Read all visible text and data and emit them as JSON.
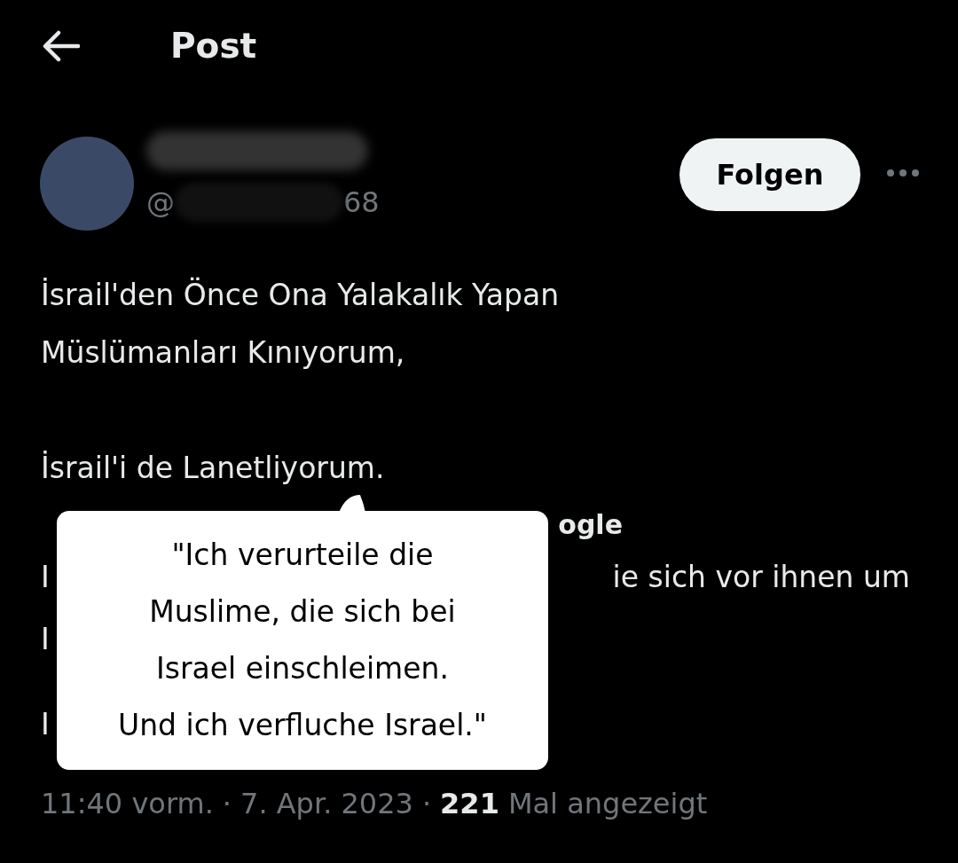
{
  "header": {
    "title": "Post"
  },
  "author": {
    "handle_start": "@",
    "handle_end": "68"
  },
  "follow_button": {
    "label": "Folgen"
  },
  "post": {
    "lines": [
      "İsrail'den Önce Ona Yalakalık Yapan",
      "Müslümanları Kınıyorum,",
      "İsrail'i de Lanetliyorum."
    ]
  },
  "translation": {
    "link_fragment": "ogle",
    "rows": [
      {
        "left": "I",
        "right": "ie sich vor ihnen um"
      },
      {
        "left": "I",
        "right": ""
      },
      {
        "left": "I",
        "right": ""
      }
    ]
  },
  "meta": {
    "separator": "·",
    "time": "11:40 vorm.",
    "date": "7. Apr. 2023",
    "views": "221",
    "views_label": "Mal angezeigt"
  },
  "sticker": {
    "lines": [
      "\"Ich verurteile die",
      "Muslime, die sich bei",
      "Israel einschleimen.",
      "Und ich verfluche Israel.\""
    ]
  }
}
